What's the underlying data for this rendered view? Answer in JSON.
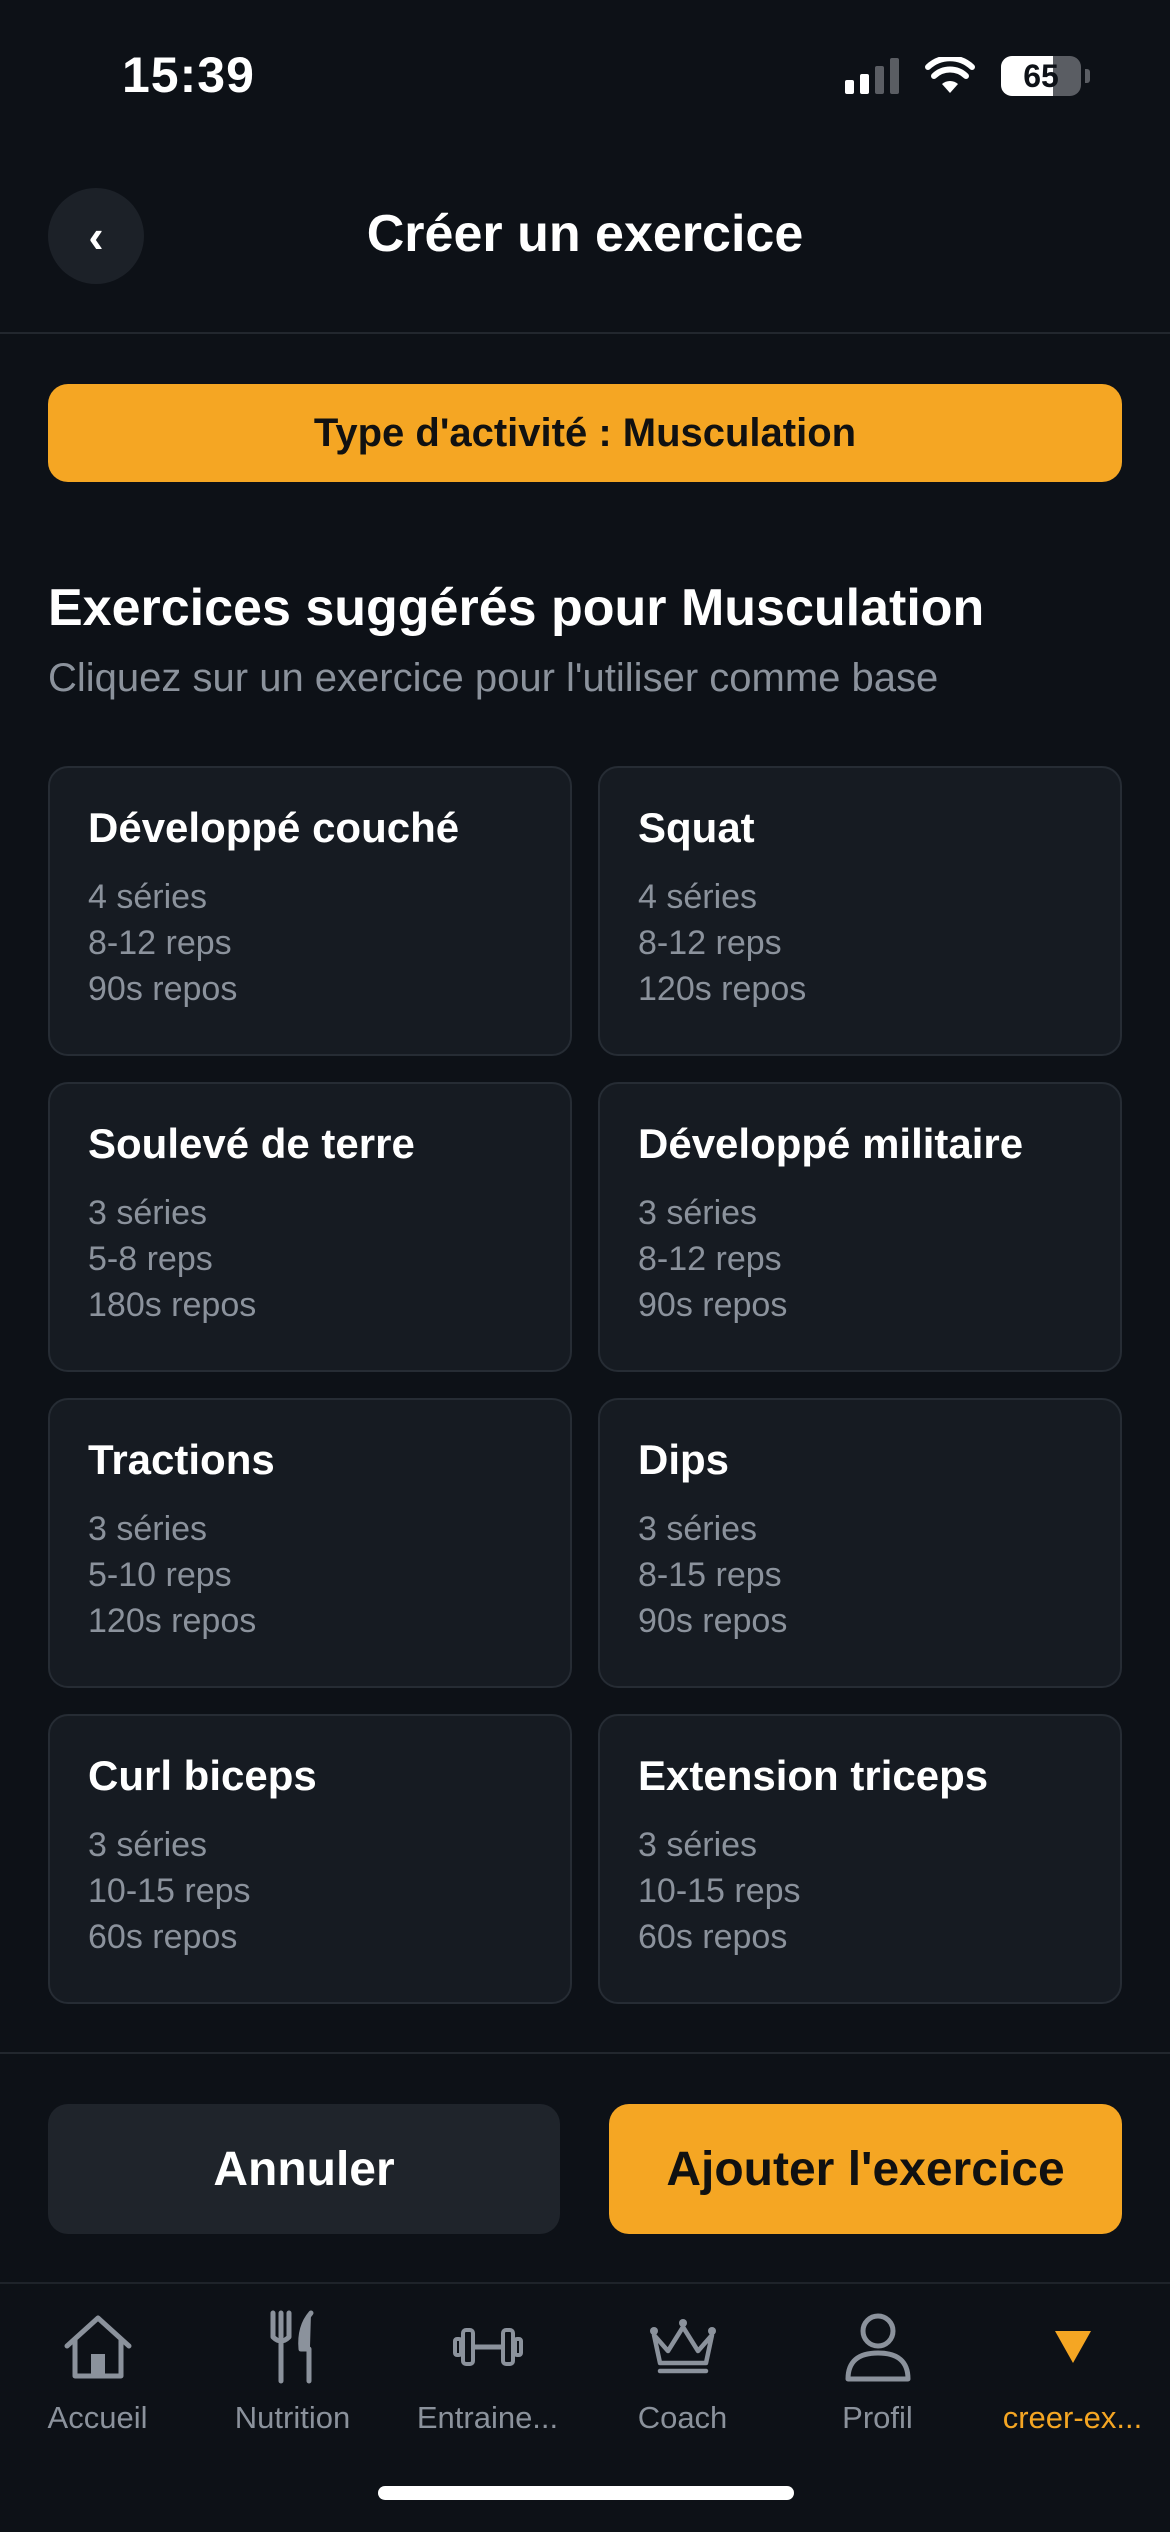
{
  "status_bar": {
    "time": "15:39",
    "battery": "65",
    "battery_level": 0.65
  },
  "header": {
    "back_label": "‹",
    "title": "Créer un exercice"
  },
  "activity_badge": "Type d'activité : Musculation",
  "section": {
    "title": "Exercices suggérés pour Musculation",
    "subtitle": "Cliquez sur un exercice pour l'utiliser comme base"
  },
  "exercises": [
    {
      "name": "Développé couché",
      "sets": "4 séries",
      "reps": "8-12 reps",
      "rest": "90s repos"
    },
    {
      "name": "Squat",
      "sets": "4 séries",
      "reps": "8-12 reps",
      "rest": "120s repos"
    },
    {
      "name": "Soulevé de terre",
      "sets": "3 séries",
      "reps": "5-8 reps",
      "rest": "180s repos"
    },
    {
      "name": "Développé militaire",
      "sets": "3 séries",
      "reps": "8-12 reps",
      "rest": "90s repos"
    },
    {
      "name": "Tractions",
      "sets": "3 séries",
      "reps": "5-10 reps",
      "rest": "120s repos"
    },
    {
      "name": "Dips",
      "sets": "3 séries",
      "reps": "8-15 reps",
      "rest": "90s repos"
    },
    {
      "name": "Curl biceps",
      "sets": "3 séries",
      "reps": "10-15 reps",
      "rest": "60s repos"
    },
    {
      "name": "Extension triceps",
      "sets": "3 séries",
      "reps": "10-15 reps",
      "rest": "60s repos"
    }
  ],
  "footer": {
    "cancel_label": "Annuler",
    "add_label": "Ajouter l'exercice"
  },
  "tabs": [
    {
      "label": "Accueil",
      "icon": "home-icon"
    },
    {
      "label": "Nutrition",
      "icon": "fork-knife-icon"
    },
    {
      "label": "Entraine...",
      "icon": "dumbbell-icon"
    },
    {
      "label": "Coach",
      "icon": "crown-icon"
    },
    {
      "label": "Profil",
      "icon": "person-icon"
    },
    {
      "label": "creer-ex...",
      "icon": "triangle-down-icon",
      "active": true
    }
  ],
  "colors": {
    "accent": "#f5a623",
    "background": "#0d1117",
    "card": "#161b22",
    "muted": "#8b929c"
  }
}
